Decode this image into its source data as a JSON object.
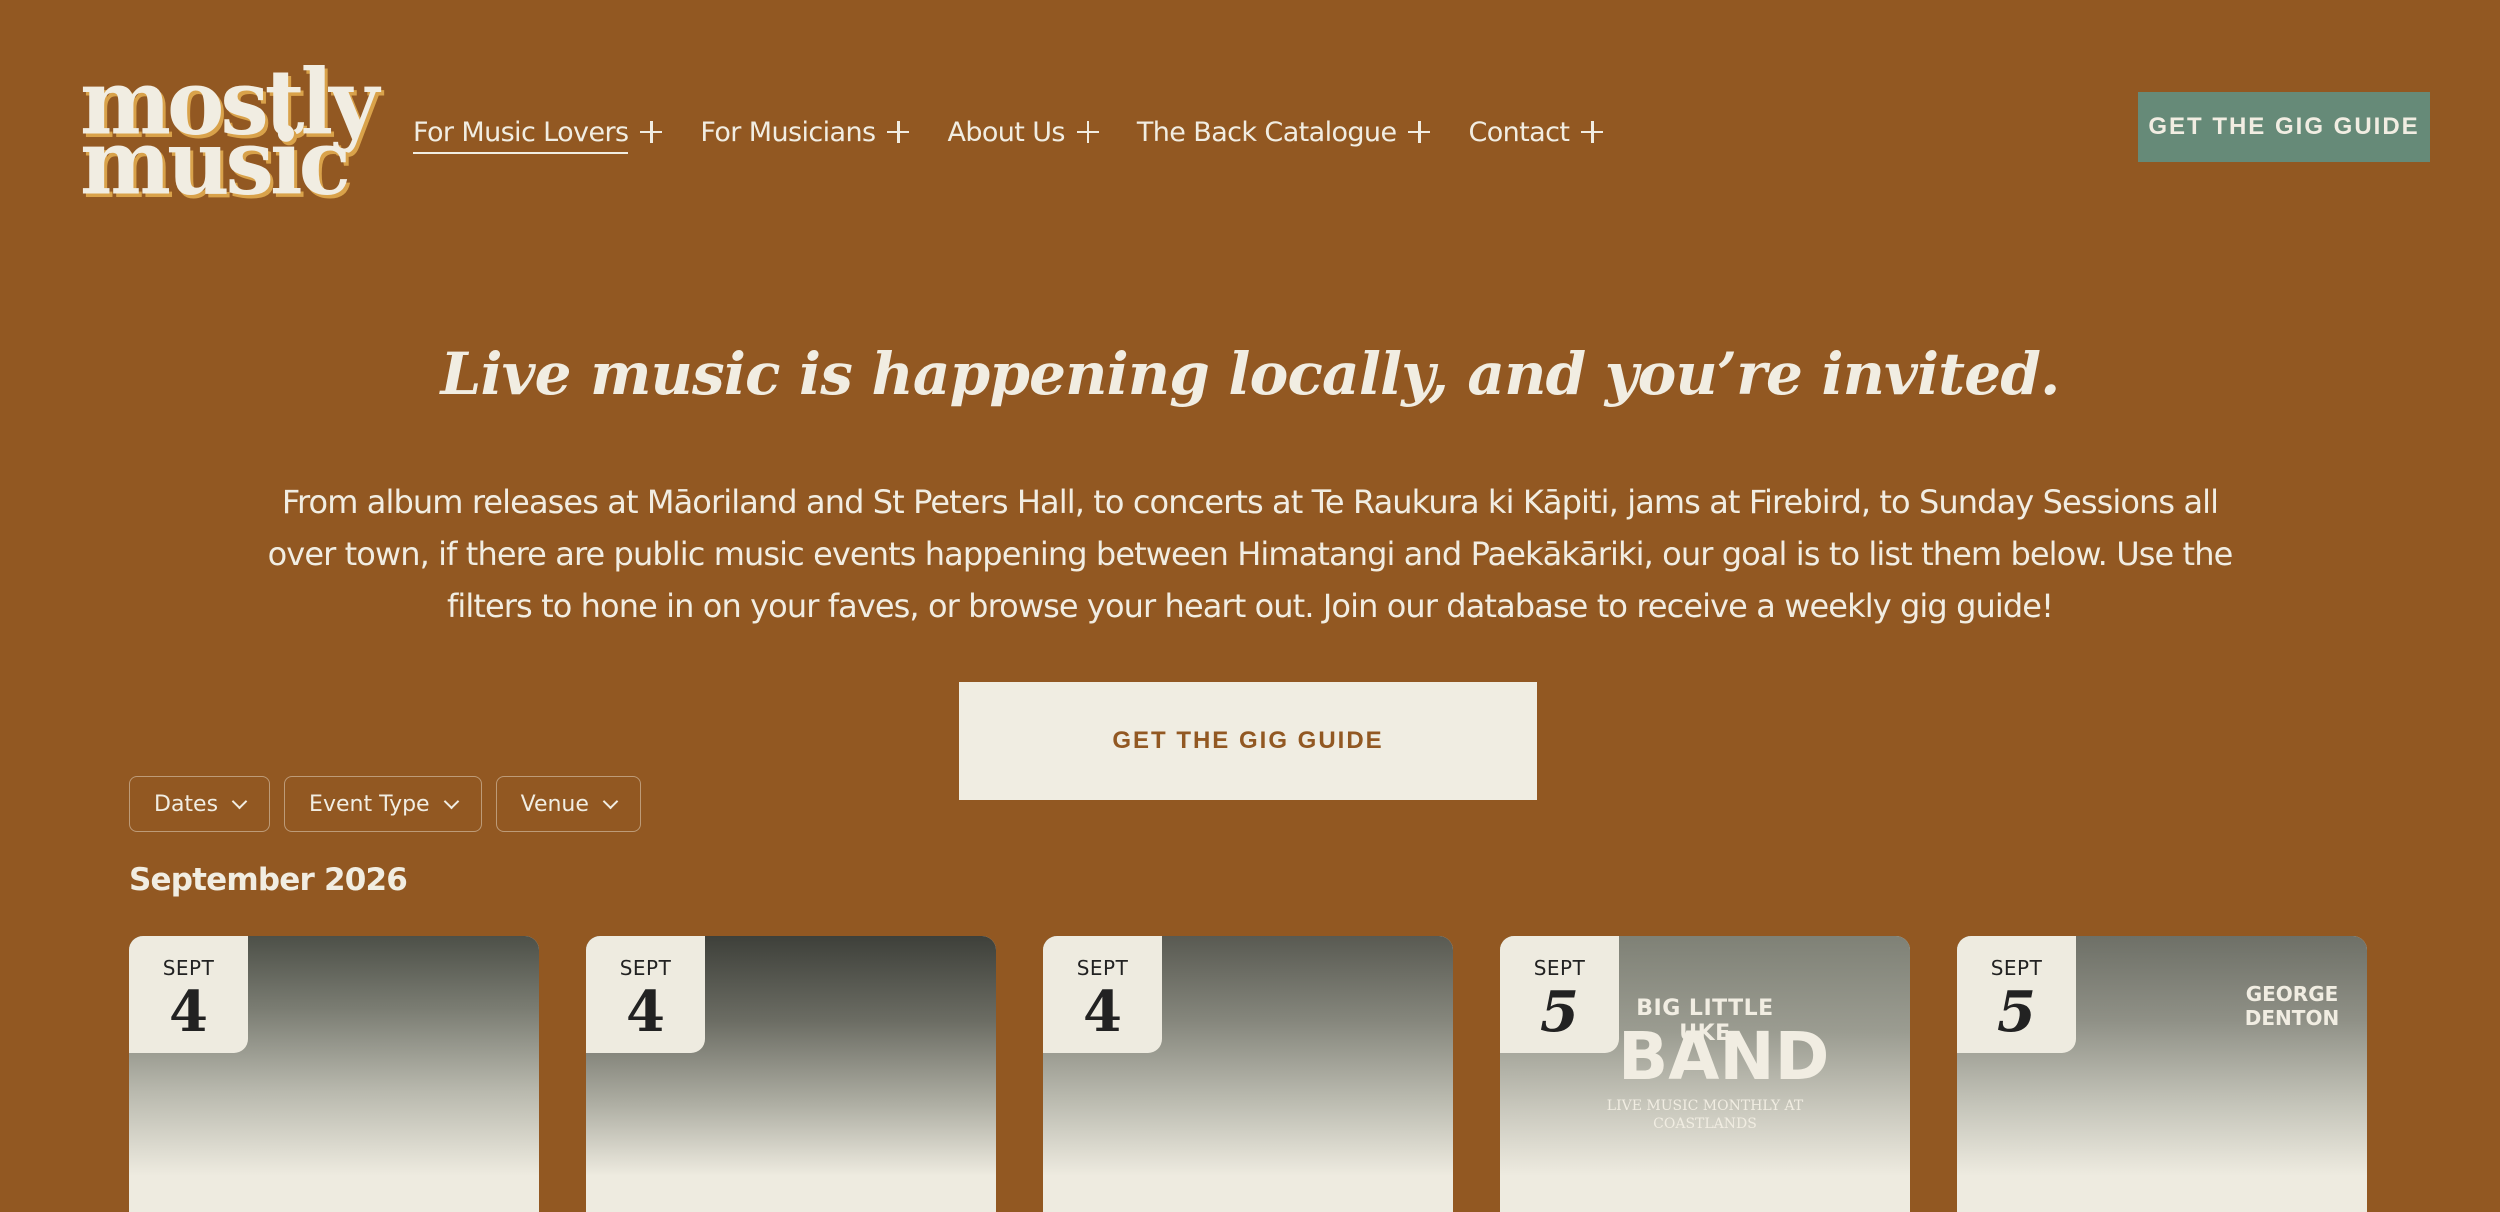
{
  "logo": {
    "line1": "mostly",
    "line2": "music"
  },
  "nav": {
    "items": [
      {
        "label": "For Music Lovers"
      },
      {
        "label": "For Musicians"
      },
      {
        "label": "About Us"
      },
      {
        "label": "The Back Catalogue"
      },
      {
        "label": "Contact"
      }
    ]
  },
  "header": {
    "cta_label": "GET THE GIG GUIDE"
  },
  "hero": {
    "title": "Live music is happening locally, and you’re invited.",
    "text": "From album releases at Māoriland and St Peters Hall, to concerts at Te Raukura ki Kāpiti, jams at Firebird, to Sunday Sessions all over town, if there are public music events happening between Himatangi and Paekākāriki, our goal is to list them below. Use the filters to hone in on your faves, or browse your heart out. Join our database to receive a weekly gig guide!",
    "cta_label": "GET THE GIG GUIDE"
  },
  "filters": [
    {
      "label": "Dates"
    },
    {
      "label": "Event Type"
    },
    {
      "label": "Venue"
    }
  ],
  "events": {
    "month_heading": "September 2026",
    "cards": [
      {
        "month": "SEPT",
        "day": "4"
      },
      {
        "month": "SEPT",
        "day": "4"
      },
      {
        "month": "SEPT",
        "day": "4"
      },
      {
        "month": "SEPT",
        "day": "5",
        "poster": {
          "line1": "BIG LITTLE UKE",
          "line2": "BAND",
          "line3": "LIVE MUSIC MONTHLY AT",
          "line4": "COASTLANDS"
        }
      },
      {
        "month": "SEPT",
        "day": "5",
        "poster": {
          "line1": "GEORGE",
          "line2": "DENTON"
        }
      }
    ]
  },
  "colors": {
    "background": "#925822",
    "accent_green": "#668a78",
    "cream": "#f0ede2"
  }
}
